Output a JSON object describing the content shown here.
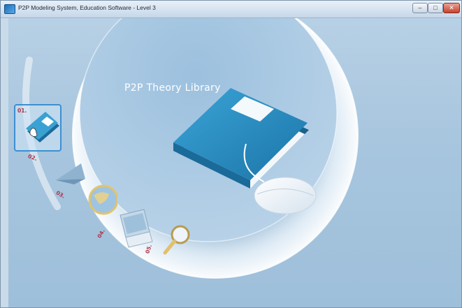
{
  "window": {
    "title": "P2P Modeling System, Education Software - Level 3",
    "buttons": {
      "minimize": "–",
      "maximize": "□",
      "close": "✕"
    }
  },
  "main": {
    "library_title": "P2P Theory Library",
    "center_icon": "book-mouse-icon"
  },
  "menu": {
    "items": [
      {
        "number": "01.",
        "icon": "book-icon",
        "selected": true
      },
      {
        "number": "02.",
        "icon": "paper-plane-icon",
        "selected": false
      },
      {
        "number": "03.",
        "icon": "globe-icon",
        "selected": false
      },
      {
        "number": "04.",
        "icon": "laptop-icon",
        "selected": false
      },
      {
        "number": "05.",
        "icon": "magnifier-icon",
        "selected": false
      }
    ]
  },
  "colors": {
    "background": "#a7c5de",
    "book_blue": "#2f8dbf",
    "number_red": "#b03548",
    "title_bar": "#c6d7e8"
  }
}
